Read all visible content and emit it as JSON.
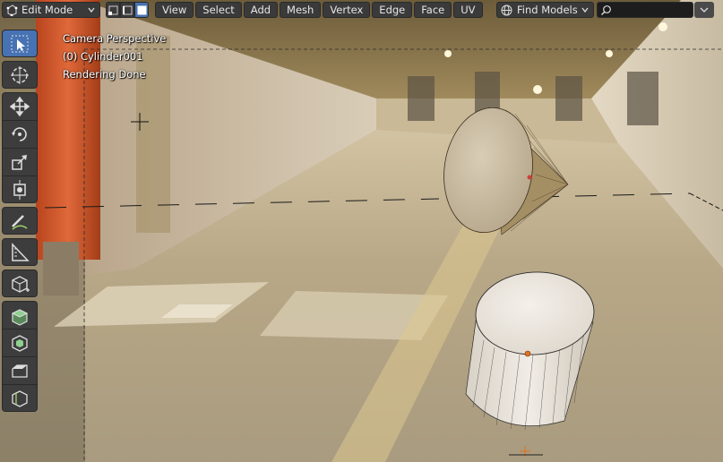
{
  "header": {
    "mode": "Edit Mode",
    "menus": [
      "View",
      "Select",
      "Add",
      "Mesh",
      "Vertex",
      "Edge",
      "Face",
      "UV"
    ],
    "find_models": "Find Models",
    "search_placeholder": ""
  },
  "overlay": {
    "line1": "Camera Perspective",
    "line2": "(0) Cylinder001",
    "line3": "Rendering Done"
  },
  "toolbar": {
    "tools": [
      {
        "name": "select-box",
        "icon": "select-arrow-icon",
        "active": true
      },
      {
        "name": "cursor",
        "icon": "cursor-icon",
        "active": false
      },
      {
        "name": "move",
        "icon": "move-icon",
        "active": false
      },
      {
        "name": "rotate",
        "icon": "rotate-icon",
        "active": false
      },
      {
        "name": "scale",
        "icon": "scale-icon",
        "active": false
      },
      {
        "name": "transform",
        "icon": "transform-icon",
        "active": false
      },
      {
        "name": "annotate",
        "icon": "annotate-icon",
        "active": false
      },
      {
        "name": "measure",
        "icon": "measure-icon",
        "active": false
      },
      {
        "name": "add-cube",
        "icon": "add-cube-icon",
        "active": false
      },
      {
        "name": "extrude",
        "icon": "extrude-icon",
        "active": false
      },
      {
        "name": "inset",
        "icon": "inset-icon",
        "active": false
      },
      {
        "name": "bevel",
        "icon": "bevel-icon",
        "active": false
      },
      {
        "name": "loop-cut",
        "icon": "loop-cut-icon",
        "active": false
      }
    ]
  },
  "colors": {
    "active_blue": "#4772b3",
    "header_bg": "#3a3a3a",
    "vertex_orange": "#e07020"
  }
}
